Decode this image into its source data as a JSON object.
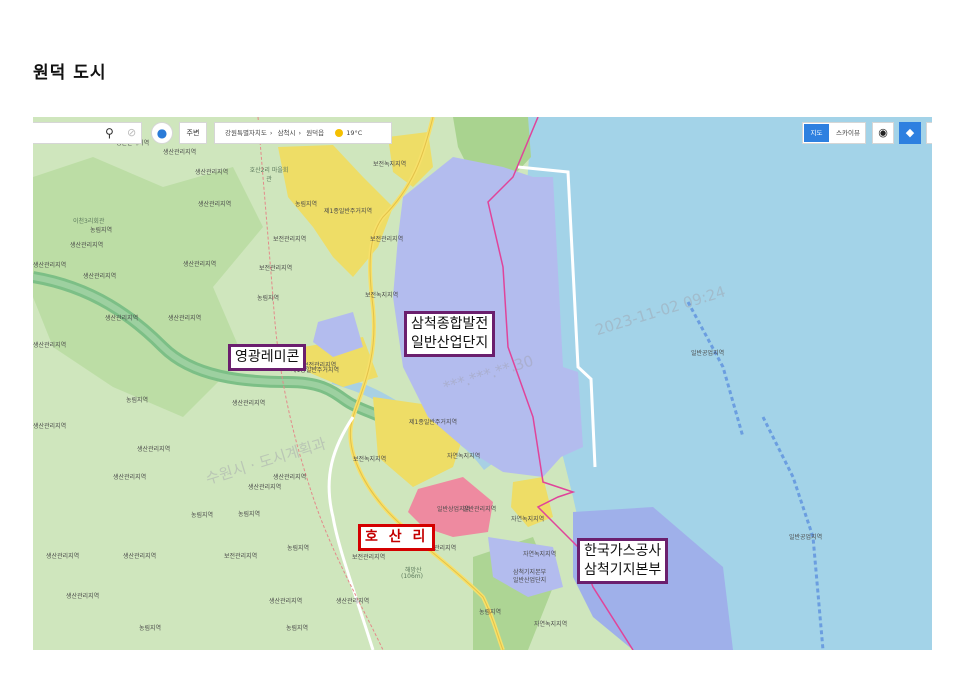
{
  "page_title": "원덕 도시",
  "toolbar": {
    "search_icon": "search-icon",
    "clear_icon": "clear-icon",
    "pin_icon": "map-pin-icon",
    "nearby_label": "주변",
    "breadcrumb": [
      "강원특별자치도",
      "삼척시",
      "원덕읍"
    ],
    "temperature": "19°C",
    "map_type_on": "지도",
    "map_type_off": "스카이뷰",
    "location_icon": "location-pin-icon",
    "layer_icon": "layers-icon"
  },
  "callouts": {
    "plant": [
      "삼척종합발전",
      "일반산업단지"
    ],
    "remicon": "영광레미콘",
    "hosan": "호 산 리",
    "kogas": [
      "한국가스공사",
      "삼척기지본부"
    ]
  },
  "watermarks": {
    "timestamp": "2023-11-02 09:24",
    "ip": "***.***.**.30",
    "agency": "수원시 · 도시계획과"
  },
  "places": {
    "mountain": "해망산",
    "elevation": "(106m)",
    "village": "호산2리 마을회관",
    "hall": "이천3리회관"
  },
  "zones": [
    {
      "t": "생산관리지역"
    },
    {
      "t": "생산관리지역"
    },
    {
      "t": "생산관리지역"
    },
    {
      "t": "보전녹지지역"
    },
    {
      "t": "제1종일반주거지역"
    },
    {
      "t": "생산관리지역"
    },
    {
      "t": "농림지역"
    },
    {
      "t": "생산관리지역"
    },
    {
      "t": "생산관리지역"
    },
    {
      "t": "보전관리지역"
    },
    {
      "t": "생산관리지역"
    },
    {
      "t": "농림지역"
    },
    {
      "t": "생산관리지역"
    },
    {
      "t": "생산관리지역"
    },
    {
      "t": "보전녹지지역"
    },
    {
      "t": "생산관리지역"
    },
    {
      "t": "제1종일반주거지역"
    },
    {
      "t": "농림지역"
    },
    {
      "t": "생산관리지역"
    },
    {
      "t": "생산관리지역"
    },
    {
      "t": "제1종일반주거지역"
    },
    {
      "t": "생산관리지역"
    },
    {
      "t": "보전녹지지역"
    },
    {
      "t": "자연녹지지역"
    },
    {
      "t": "생산관리지역"
    },
    {
      "t": "일반상업지역"
    },
    {
      "t": "자연녹지지역"
    },
    {
      "t": "보전관리지역"
    },
    {
      "t": "생산관리지역"
    },
    {
      "t": "생산관리지역"
    },
    {
      "t": "농림지역"
    },
    {
      "t": "보전관리지역"
    },
    {
      "t": "자연녹지지역"
    },
    {
      "t": "보전관리지역"
    },
    {
      "t": "생산관리지역"
    },
    {
      "t": "생산관리지역"
    },
    {
      "t": "생산관리지역"
    },
    {
      "t": "농림지역"
    },
    {
      "t": "농림지역"
    },
    {
      "t": "자연녹지지역"
    },
    {
      "t": "일반공업지역"
    },
    {
      "t": "일반공업지역"
    },
    {
      "t": "보전관리지역"
    },
    {
      "t": "일반관리지역"
    },
    {
      "t": "농림지역"
    },
    {
      "t": "생산관리지역"
    },
    {
      "t": "보전관리지역"
    },
    {
      "t": "보전관리지역"
    },
    {
      "t": "농림지역"
    },
    {
      "t": "생산관리지역"
    },
    {
      "t": "생산관리지역"
    },
    {
      "t": "농림지역"
    },
    {
      "t": "농림지역"
    },
    {
      "t": "삼척기지본부"
    },
    {
      "t": "일반산업단지"
    }
  ],
  "colors": {
    "sea": "#a3d3e8",
    "industrial": "#b3bcee",
    "residential": "#eedd66",
    "commercial": "#ee8aa0",
    "green_zone": "#cfe6bd",
    "forest": "#a9d38f",
    "boundary": "#e0449a",
    "callout_purple": "#6b1f6e",
    "callout_red": "#d40000"
  }
}
